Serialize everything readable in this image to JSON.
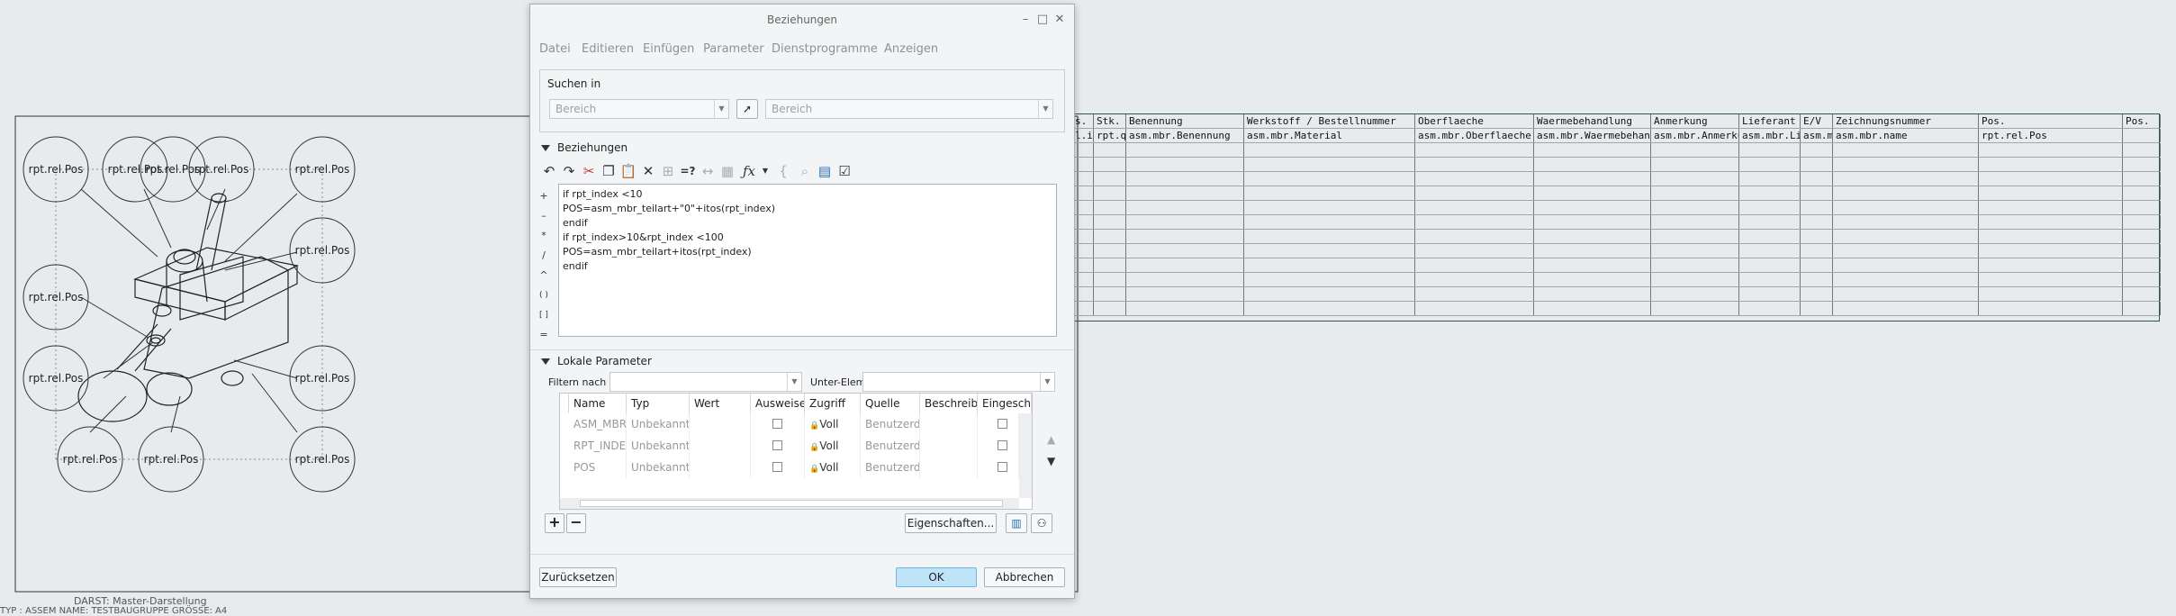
{
  "drawing": {
    "balloon_label": "rpt.rel.Pos",
    "sheet_info": "DARST: Master-Darstellung",
    "sheet_info2": "TYP : ASSEM    NAME: TESTBAUGRUPPE    GRÖSSE: A4"
  },
  "bom": {
    "headers": [
      "s.",
      "Stk.",
      "Benennung",
      "Werkstoff / Bestellnummer",
      "Oberflaeche",
      "Waermebehandlung",
      "Anmerkung",
      "Lieferant",
      "E/V",
      "Zeichnungsnummer",
      "Pos.",
      "Pos."
    ],
    "values": [
      "l.index",
      "rpt.qty",
      "asm.mbr.Benennung",
      "asm.mbr.Material",
      "asm.mbr.Oberflaeche",
      "asm.mbr.Waermebehandlung",
      "asm.mbr.Anmerkung",
      "asm.mbr.Lieferant",
      "asm.mbr.E/V",
      "asm.mbr.name",
      "rpt.rel.Pos",
      ""
    ]
  },
  "dialog": {
    "title": "Beziehungen",
    "menu": [
      "Datei",
      "Editieren",
      "Einfügen",
      "Parameter",
      "Dienstprogramme",
      "Anzeigen"
    ],
    "search": {
      "title": "Suchen in",
      "scope1": "Bereich",
      "scope2": "Bereich"
    },
    "relations": {
      "title": "Beziehungen",
      "side_ops": [
        "+",
        "–",
        "*",
        "/",
        "^",
        "( )",
        "[ ]",
        "="
      ],
      "code": [
        "if rpt_index <10",
        "POS=asm_mbr_teilart+\"0\"+itos(rpt_index)",
        "endif",
        "if rpt_index>10&rpt_index <100",
        "POS=asm_mbr_teilart+itos(rpt_index)",
        "endif"
      ]
    },
    "local_params": {
      "title": "Lokale Parameter",
      "filter_label": "Filtern nach",
      "sub_label": "Unter-Elem",
      "columns": [
        "Name",
        "Typ",
        "Wert",
        "Ausweise",
        "Zugriff",
        "Quelle",
        "Beschreib",
        "Eingeschr"
      ],
      "rows": [
        {
          "name": "ASM_MBR",
          "type": "Unbekannt",
          "access": "Voll",
          "source": "Benutzerde"
        },
        {
          "name": "RPT_INDEX",
          "type": "Unbekannt",
          "access": "Voll",
          "source": "Benutzerde"
        },
        {
          "name": "POS",
          "type": "Unbekannt",
          "access": "Voll",
          "source": "Benutzerde"
        }
      ],
      "properties_button": "Eigenschaften..."
    },
    "buttons": {
      "reset": "Zurücksetzen",
      "ok": "OK",
      "cancel": "Abbrechen"
    }
  }
}
